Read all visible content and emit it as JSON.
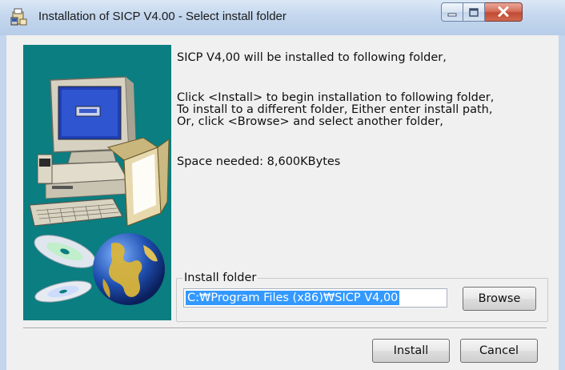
{
  "window": {
    "title": "Installation of SICP V4.00 - Select install folder",
    "icons": {
      "app": "installer-icon",
      "minimize": "minimize-icon",
      "maximize": "maximize-icon",
      "close": "close-icon"
    },
    "colors": {
      "banner": "#0a7e80",
      "selection": "#3399ff",
      "close_button": "#c24a33"
    }
  },
  "banner": {
    "icons": [
      "computer-icon",
      "cd-disc-icon",
      "globe-icon"
    ]
  },
  "body": {
    "intro": "SICP V4,00 will be installed to following folder,",
    "instructions": [
      "Click <Install> to begin installation to following folder,",
      "To install to a different folder, Either enter install path,",
      "Or, click <Browse> and select another folder,"
    ],
    "space_needed": "Space needed: 8,600KBytes"
  },
  "install_folder": {
    "label": "Install folder",
    "path": "C:₩Program Files (x86)₩SICP V4,00",
    "browse_label": "Browse"
  },
  "footer": {
    "install_label": "Install",
    "cancel_label": "Cancel"
  }
}
